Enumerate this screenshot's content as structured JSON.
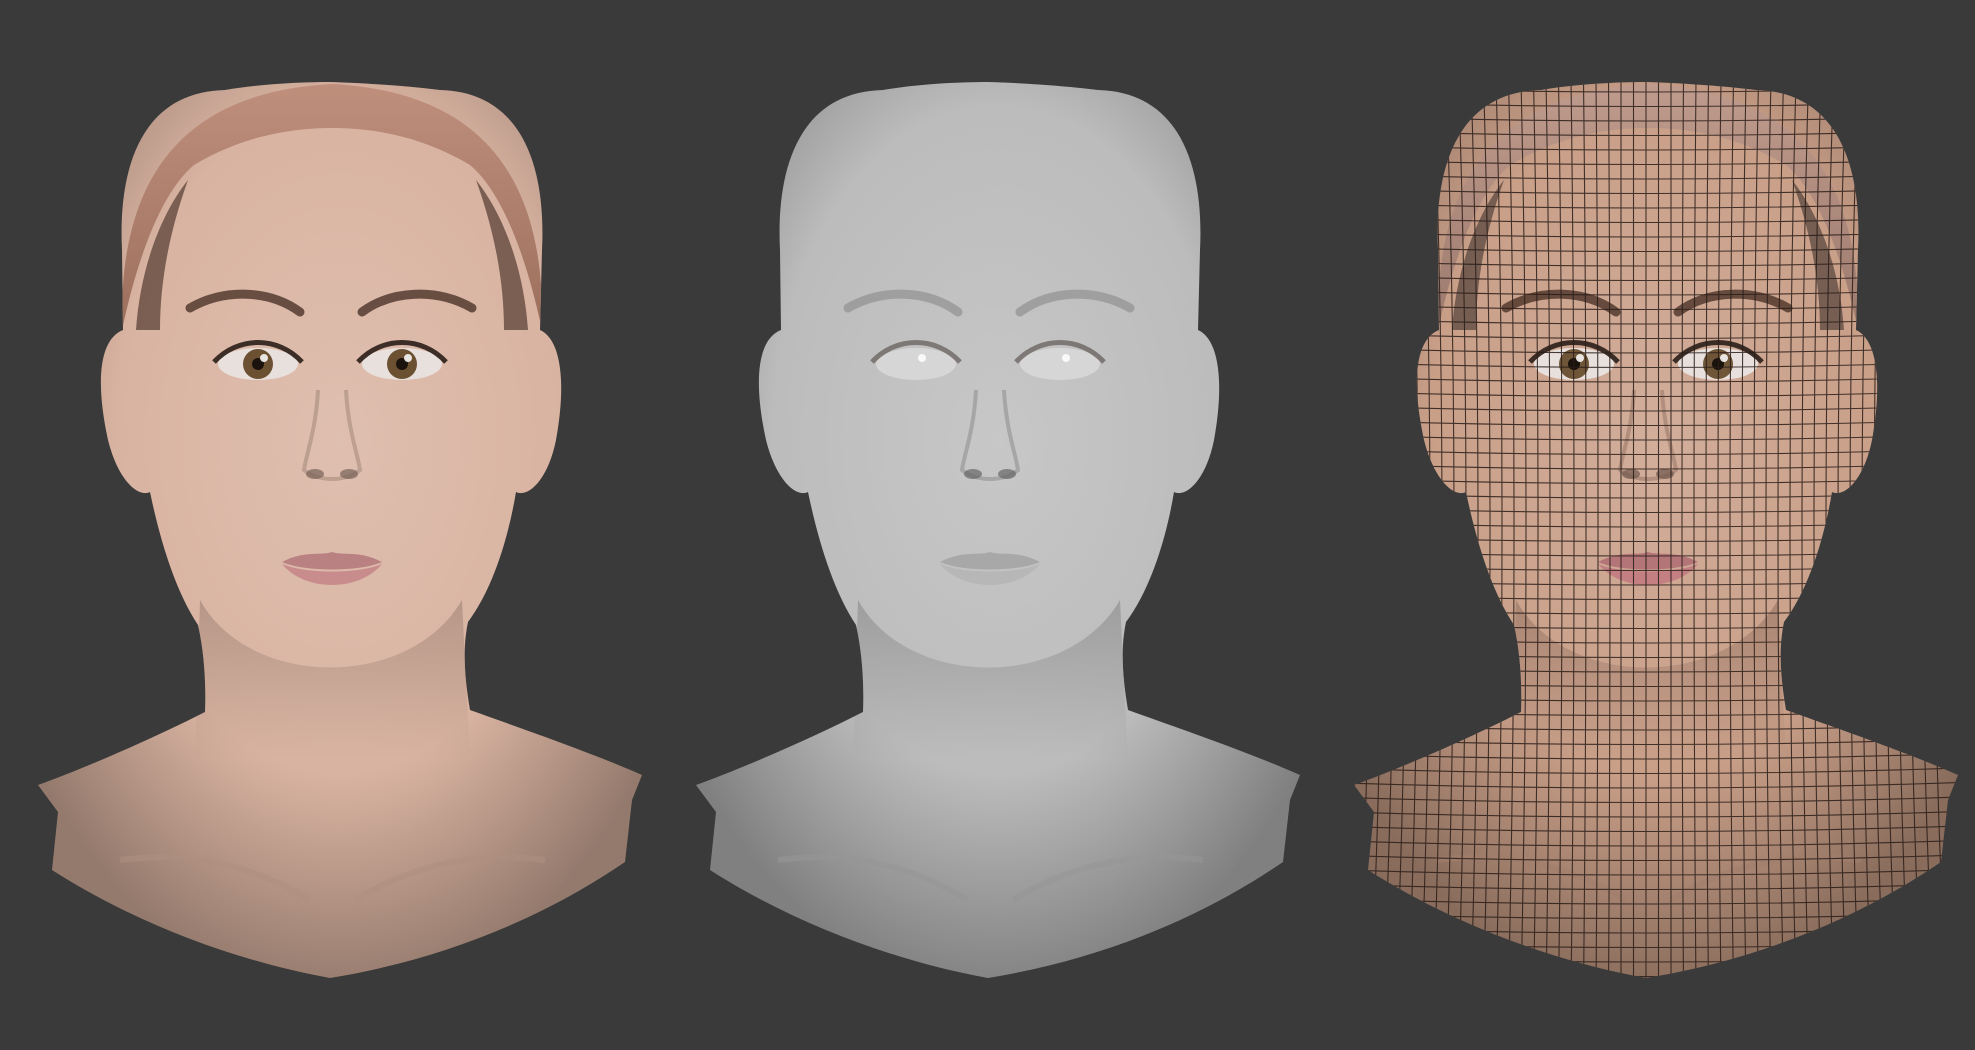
{
  "scene": {
    "background_color": "#3a3a3a",
    "views": [
      {
        "id": "textured",
        "render_mode": "textured",
        "skin_color": "#d9b3a1",
        "cap_color": "#b8826d",
        "lip_color": "#c98c8c",
        "iris_color": "#6b5032"
      },
      {
        "id": "clay",
        "render_mode": "clay",
        "skin_color": "#bcbcbc",
        "cap_color": "#c4c4c4",
        "lip_color": "#b7b7b7",
        "iris_color": "#e8e8e8"
      },
      {
        "id": "wire",
        "render_mode": "wireframe",
        "skin_color": "#c99f88",
        "cap_color": "#b89080",
        "lip_color": "#c47f82",
        "iris_color": "#6f5638",
        "wire_color": "#2a1d18"
      }
    ]
  }
}
